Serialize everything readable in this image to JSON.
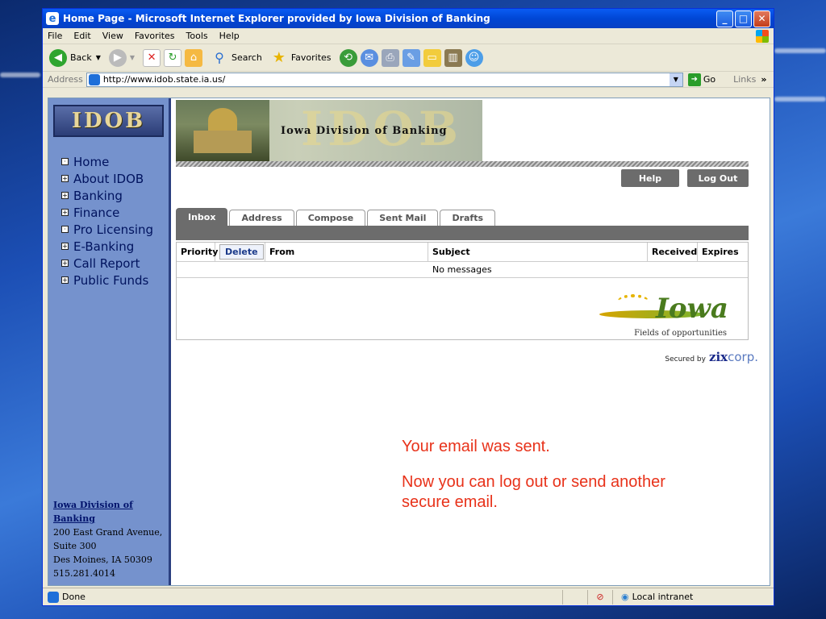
{
  "window": {
    "title": "Home Page - Microsoft Internet Explorer provided by Iowa Division of Banking",
    "minimize": "_",
    "maximize": "□",
    "close": "✕"
  },
  "menu": [
    "File",
    "Edit",
    "View",
    "Favorites",
    "Tools",
    "Help"
  ],
  "toolbar": {
    "back": "Back",
    "search": "Search",
    "favorites": "Favorites"
  },
  "address": {
    "label": "Address",
    "url": "http://www.idob.state.ia.us/",
    "go": "Go",
    "links": "Links"
  },
  "sidebar": {
    "logo": "IDOB",
    "items": [
      {
        "label": "Home",
        "box": "·"
      },
      {
        "label": "About IDOB",
        "box": "+"
      },
      {
        "label": "Banking",
        "box": "+"
      },
      {
        "label": "Finance",
        "box": "+"
      },
      {
        "label": "Pro Licensing",
        "box": "·"
      },
      {
        "label": "E-Banking",
        "box": "+"
      },
      {
        "label": "Call Report",
        "box": "+"
      },
      {
        "label": "Public Funds",
        "box": "+"
      }
    ],
    "contact": {
      "org": "Iowa Division of Banking",
      "line1": "200 East Grand Avenue,",
      "line2": "Suite 300",
      "line3": "Des Moines, IA 50309",
      "phone": "515.281.4014"
    }
  },
  "banner": {
    "title": "Iowa Division of Banking",
    "big": "IDOB"
  },
  "header_buttons": {
    "help": "Help",
    "logout": "Log Out"
  },
  "tabs": [
    "Inbox",
    "Address",
    "Compose",
    "Sent Mail",
    "Drafts"
  ],
  "table": {
    "columns": {
      "priority": "Priority",
      "delete": "Delete",
      "from": "From",
      "subject": "Subject",
      "received": "Received",
      "expires": "Expires"
    },
    "empty_text": "No messages"
  },
  "iowa_logo": {
    "word": "Iowa",
    "tagline": "Fields of opportunities"
  },
  "secured": {
    "prefix": "Secured by",
    "brand": "zix",
    "suffix": "corp."
  },
  "messages": {
    "line1": "Your email was sent.",
    "line2a": "Now you can log out or send another",
    "line2b": "secure email."
  },
  "status": {
    "text": "Done",
    "zone": "Local intranet"
  }
}
